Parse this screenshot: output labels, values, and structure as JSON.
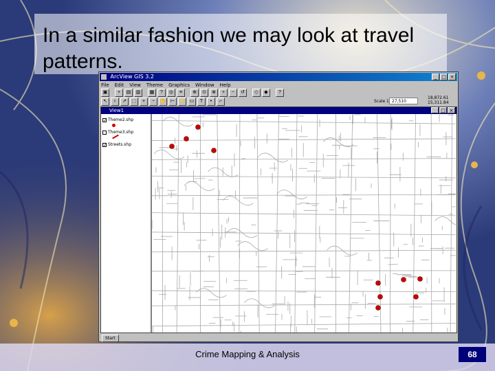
{
  "slide": {
    "title": "In a similar fashion we may look at travel patterns.",
    "footer": "Crime Mapping & Analysis",
    "page_number": "68"
  },
  "app": {
    "title": "ArcView GIS 3.2",
    "menus": [
      "File",
      "Edit",
      "View",
      "Theme",
      "Graphics",
      "Window",
      "Help"
    ],
    "scale_label": "Scale 1:",
    "scale_value": "27,510",
    "coords": [
      "18,872.61",
      "15,311.84"
    ],
    "view_title": "View1",
    "layers": [
      {
        "name": "Theme2.shp",
        "checked": true,
        "symbol": "red-dot"
      },
      {
        "name": "Theme3.shp",
        "checked": false,
        "symbol": "red-line"
      },
      {
        "name": "Streets.shp",
        "checked": true,
        "symbol": "gray-line"
      }
    ],
    "start_label": "Start"
  },
  "colors": {
    "point_marker": "#cc0000",
    "street_lines": "#a8a8a8",
    "titlebar": "#000080",
    "page_badge": "#00007a"
  }
}
